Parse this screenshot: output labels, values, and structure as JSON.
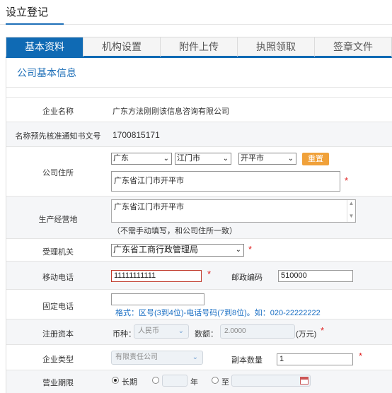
{
  "page_title": "设立登记",
  "tabs": [
    {
      "label": "基本资料"
    },
    {
      "label": "机构设置"
    },
    {
      "label": "附件上传"
    },
    {
      "label": "执照领取"
    },
    {
      "label": "签章文件"
    }
  ],
  "section_title": "公司基本信息",
  "form": {
    "company_name": {
      "label": "企业名称",
      "value": "广东方法刚刚该信息咨询有限公司"
    },
    "name_notice": {
      "label": "名称预先核准通知书文号",
      "value": "1700815171"
    },
    "address": {
      "label": "公司住所",
      "province": "广东",
      "city": "江门市",
      "district": "开平市",
      "reset_label": "重置",
      "detail": "广东省江门市开平市"
    },
    "business_place": {
      "label": "生产经营地",
      "value": "广东省江门市开平市",
      "note": "（不需手动填写，和公司住所一致）"
    },
    "authority": {
      "label": "受理机关",
      "value": "广东省工商行政管理局"
    },
    "mobile": {
      "label": "移动电话",
      "value": "11111111111"
    },
    "postcode": {
      "label": "邮政编码",
      "value": "510000"
    },
    "landline": {
      "label": "固定电话",
      "value": "",
      "hint": "格式：区号(3到4位)-电话号码(7到8位)。如：020-22222222"
    },
    "capital": {
      "label": "注册资本",
      "currency_label": "币种：",
      "currency": "人民币",
      "amount_label": "数额：",
      "amount": "2.0000",
      "unit": "(万元)"
    },
    "company_type": {
      "label": "企业类型",
      "value": "有限责任公司"
    },
    "copies": {
      "label": "副本数量",
      "value": "1"
    },
    "term": {
      "label": "营业期限",
      "long_label": "长期",
      "year_label": "年",
      "to_label": "至"
    }
  },
  "required_mark": "*"
}
